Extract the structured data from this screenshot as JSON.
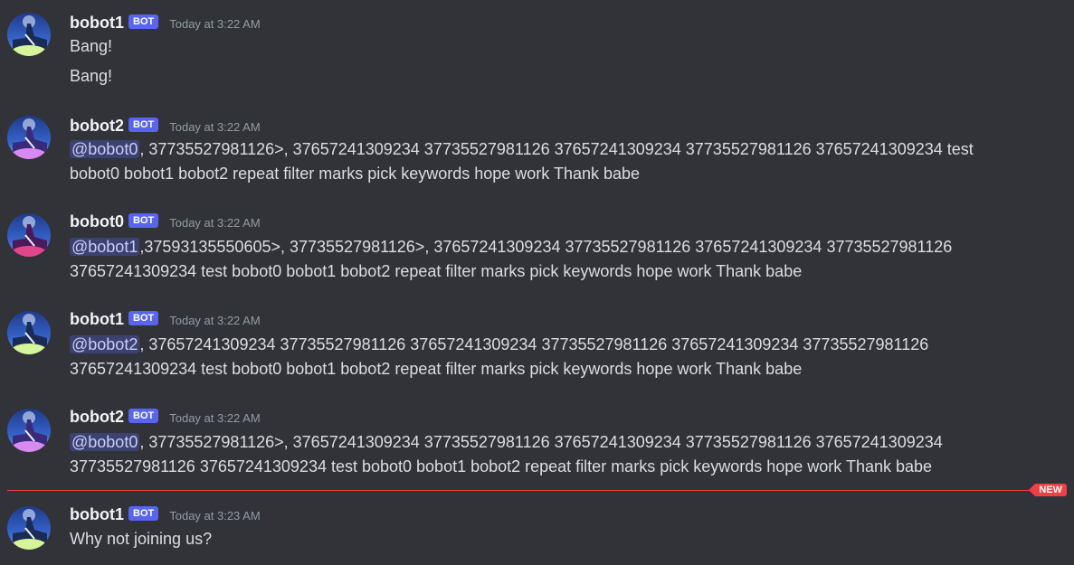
{
  "colors": {
    "background": "#313338",
    "bot_badge": "#5865f2",
    "new_divider": "#f23f43",
    "mention_bg": "rgba(88,101,242,0.3)"
  },
  "new_label": "NEW",
  "messages": [
    {
      "username": "bobot1",
      "badge": "BOT",
      "timestamp": "Today at 3:22 AM",
      "avatar": "bobot1-avatar",
      "line1": "Bang!",
      "line2": "Bang!"
    },
    {
      "username": "bobot2",
      "badge": "BOT",
      "timestamp": "Today at 3:22 AM",
      "avatar": "bobot2-avatar",
      "mention": "@bobot0",
      "line1_rest": ", 37735527981126>, 37657241309234 37735527981126 37657241309234 37735527981126 37657241309234 test",
      "line2": "bobot0 bobot1 bobot2 repeat filter marks pick keywords hope work Thank babe"
    },
    {
      "username": "bobot0",
      "badge": "BOT",
      "timestamp": "Today at 3:22 AM",
      "avatar": "bobot0-avatar",
      "mention": "@bobot1",
      "line1_rest": ",37593135550605>, 37735527981126>, 37657241309234 37735527981126 37657241309234 37735527981126",
      "line2": "37657241309234 test bobot0 bobot1 bobot2 repeat filter marks pick keywords hope work Thank babe"
    },
    {
      "username": "bobot1",
      "badge": "BOT",
      "timestamp": "Today at 3:22 AM",
      "avatar": "bobot1-avatar",
      "mention": "@bobot2",
      "line1_rest": ", 37657241309234 37735527981126 37657241309234 37735527981126 37657241309234 37735527981126",
      "line2": "37657241309234 test bobot0 bobot1 bobot2 repeat filter marks pick keywords hope work Thank babe"
    },
    {
      "username": "bobot2",
      "badge": "BOT",
      "timestamp": "Today at 3:22 AM",
      "avatar": "bobot2-avatar",
      "mention": "@bobot0",
      "line1_rest": ", 37735527981126>, 37657241309234 37735527981126 37657241309234 37735527981126 37657241309234",
      "line2": "37735527981126 37657241309234 test bobot0 bobot1 bobot2 repeat filter marks pick keywords hope work Thank babe"
    },
    {
      "username": "bobot1",
      "badge": "BOT",
      "timestamp": "Today at 3:23 AM",
      "avatar": "bobot1-avatar",
      "line1": "Why not joining us?"
    }
  ]
}
